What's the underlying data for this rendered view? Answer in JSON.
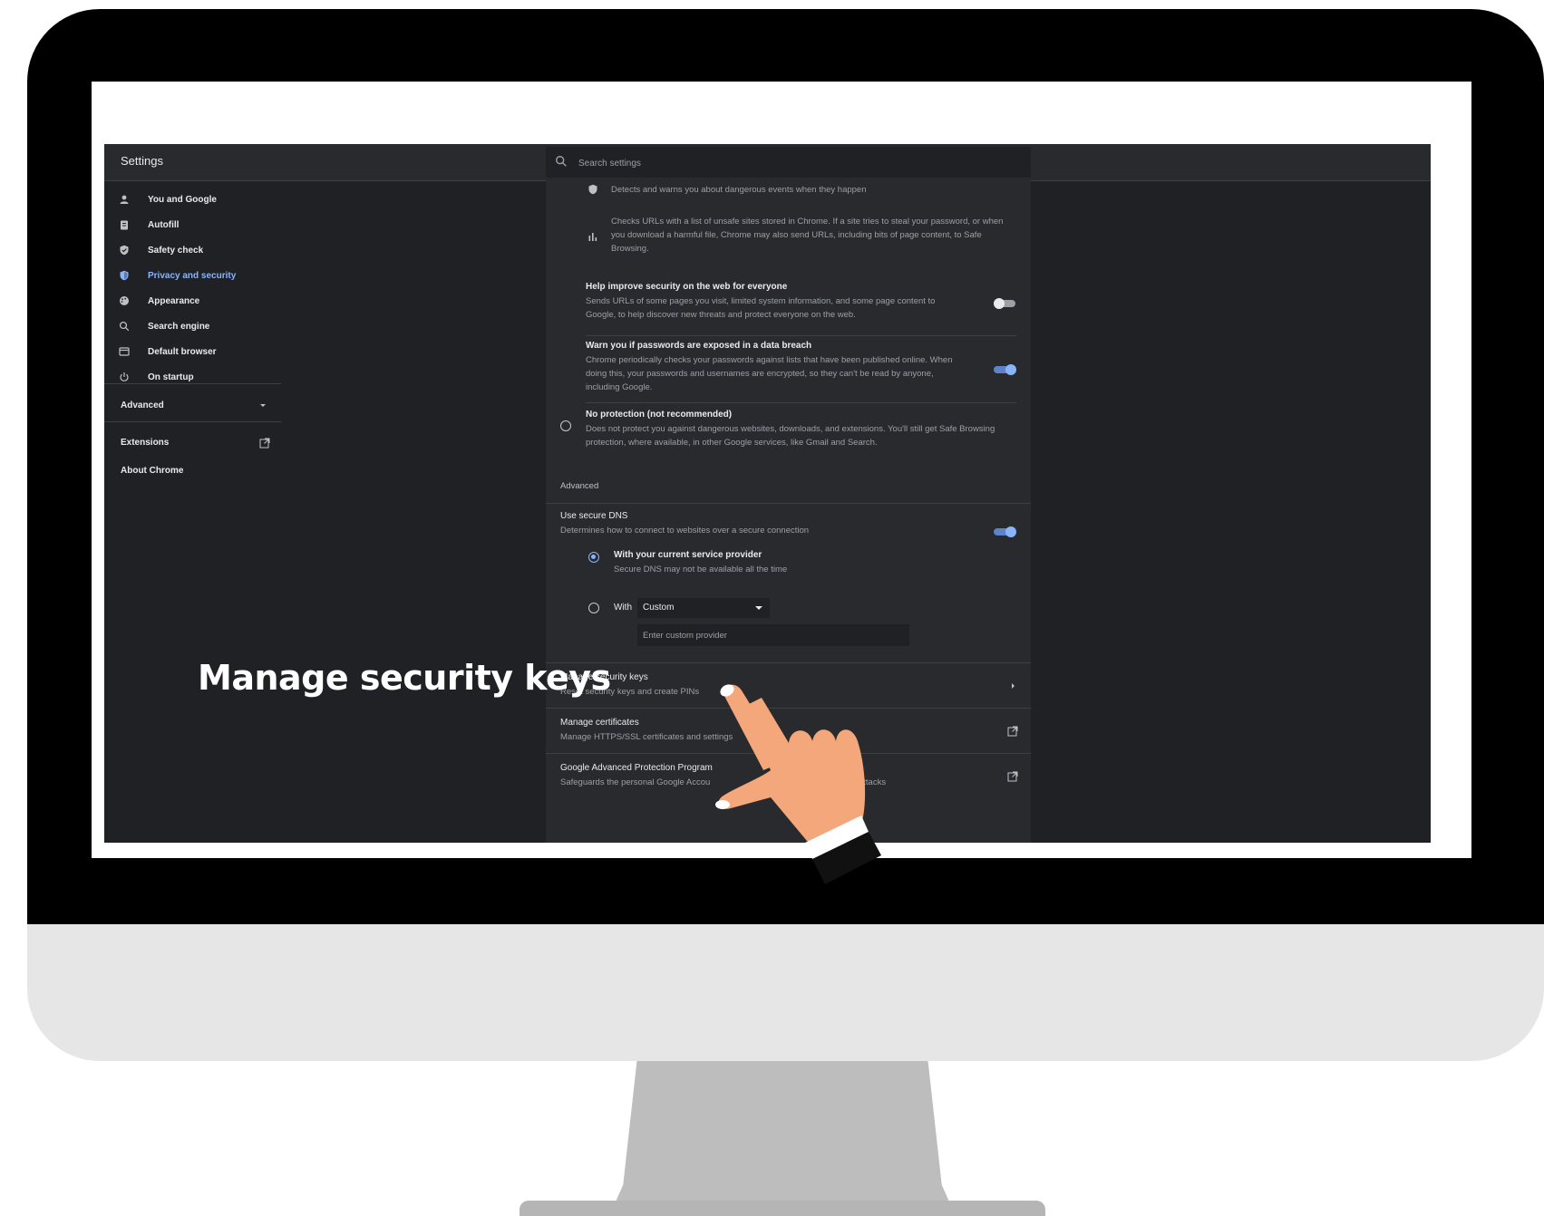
{
  "window": {
    "title": "Settings",
    "search_placeholder": "Search settings"
  },
  "sidebar": {
    "items": [
      {
        "label": "You and Google",
        "icon": "person-icon"
      },
      {
        "label": "Autofill",
        "icon": "clipboard-icon"
      },
      {
        "label": "Safety check",
        "icon": "shield-check-icon"
      },
      {
        "label": "Privacy and security",
        "icon": "shield-icon",
        "active": true
      },
      {
        "label": "Appearance",
        "icon": "palette-icon"
      },
      {
        "label": "Search engine",
        "icon": "search-icon"
      },
      {
        "label": "Default browser",
        "icon": "browser-icon"
      },
      {
        "label": "On startup",
        "icon": "power-icon"
      }
    ],
    "advanced_label": "Advanced",
    "extensions_label": "Extensions",
    "about_label": "About Chrome"
  },
  "main": {
    "detect_text": "Detects and warns you about dangerous events when they happen",
    "checks_urls_text": "Checks URLs with a list of unsafe sites stored in Chrome. If a site tries to steal your password, or when you download a harmful file, Chrome may also send URLs, including bits of page content, to Safe Browsing.",
    "help_improve": {
      "title": "Help improve security on the web for everyone",
      "desc": "Sends URLs of some pages you visit, limited system information, and some page content to Google, to help discover new threats and protect everyone on the web.",
      "enabled": false
    },
    "warn_passwords": {
      "title": "Warn you if passwords are exposed in a data breach",
      "desc": "Chrome periodically checks your passwords against lists that have been published online. When doing this, your passwords and usernames are encrypted, so they can't be read by anyone, including Google.",
      "enabled": true
    },
    "no_protection": {
      "title": "No protection (not recommended)",
      "desc": "Does not protect you against dangerous websites, downloads, and extensions. You'll still get Safe Browsing protection, where available, in other Google services, like Gmail and Search."
    },
    "advanced_heading": "Advanced",
    "secure_dns": {
      "title": "Use secure DNS",
      "desc": "Determines how to connect to websites over a secure connection",
      "enabled": true,
      "option_current": "With your current service provider",
      "option_current_desc": "Secure DNS may not be available all the time",
      "option_with": "With",
      "custom_select": "Custom",
      "custom_placeholder": "Enter custom provider"
    },
    "security_keys": {
      "title": "Manage security keys",
      "desc": "Reset security keys and create PINs"
    },
    "certificates": {
      "title": "Manage certificates",
      "desc": "Manage HTTPS/SSL certificates and settings"
    },
    "advanced_protection": {
      "title": "Google Advanced Protection Program",
      "desc": "Safeguards the personal Google Accou",
      "desc_tail": "attacks"
    }
  },
  "overlay": {
    "callout": "Manage security keys",
    "pointer": "hand-pointer-icon"
  },
  "colors": {
    "accent": "#8ab4f8",
    "background": "#202124",
    "panel": "#292a2d"
  }
}
